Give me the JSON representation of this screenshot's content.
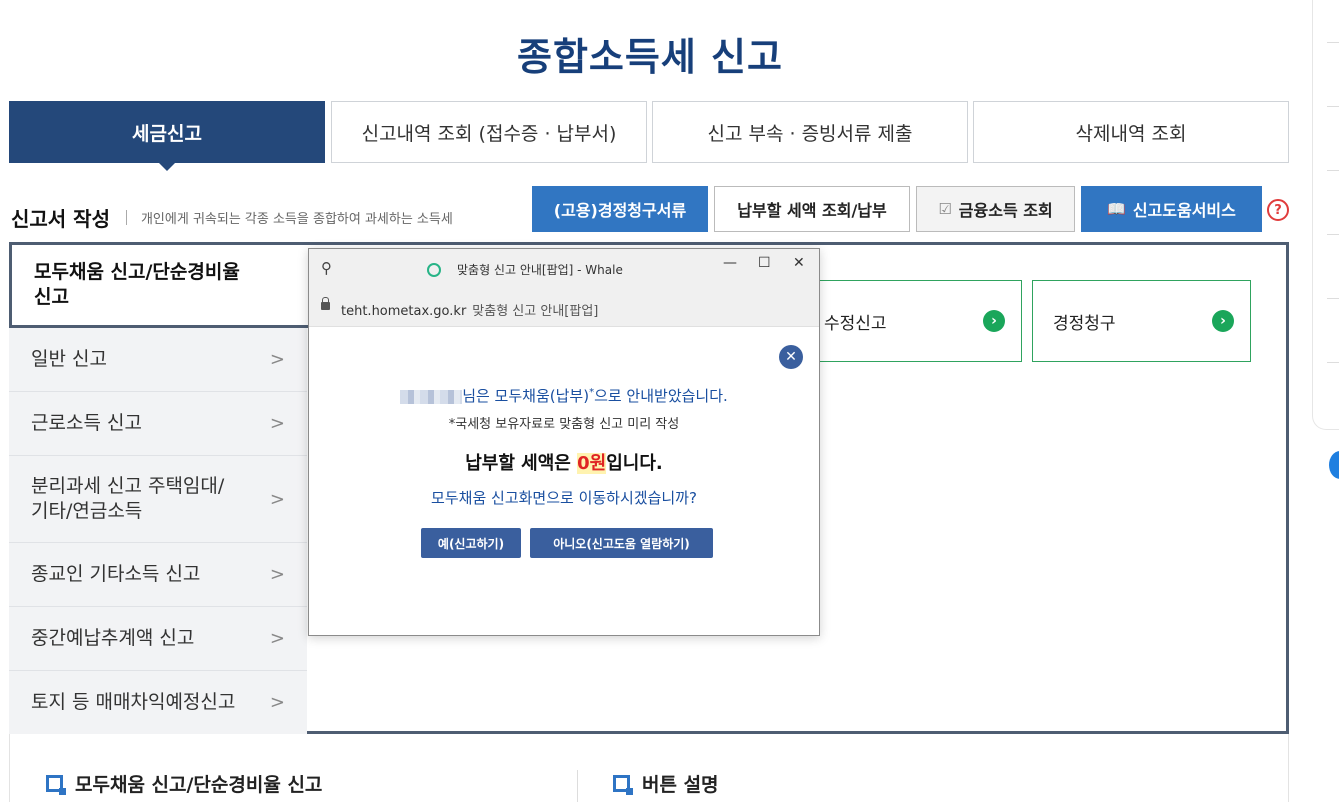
{
  "page": {
    "title": "종합소득세 신고"
  },
  "tabs": [
    {
      "label": "세금신고"
    },
    {
      "label": "신고내역 조회 (접수증 · 납부서)"
    },
    {
      "label": "신고 부속 · 증빙서류 제출"
    },
    {
      "label": "삭제내역 조회"
    }
  ],
  "section": {
    "title": "신고서 작성",
    "desc": "개인에게 귀속되는 각종 소득을 종합하여 과세하는 소득세"
  },
  "actions": {
    "correction_docs": "(고용)경정청구서류",
    "tax_payment": "납부할 세액 조회/납부",
    "financial_income": "금융소득 조회",
    "help_service": "신고도움서비스",
    "help_mark": "?"
  },
  "side_nav": [
    {
      "label": "모두채움 신고/단순경비율 신고"
    },
    {
      "label": "일반 신고"
    },
    {
      "label": "근로소득 신고"
    },
    {
      "label": "분리과세 신고 주택임대/기타/연금소득"
    },
    {
      "label": "종교인 기타소득 신고"
    },
    {
      "label": "중간예납추계액 신고"
    },
    {
      "label": "토지 등 매매차익예정신고"
    }
  ],
  "cards": [
    {
      "label": "수정신고"
    },
    {
      "label": "경정청구"
    }
  ],
  "bottom": {
    "left_heading": "모두채움 신고/단순경비율 신고",
    "right_heading": "버튼 설명"
  },
  "popup": {
    "window_title": "맞춤형 신고 안내[팝업] - Whale",
    "url_host": "teht.hometax.go.kr",
    "url_title": "맞춤형 신고 안내[팝업]",
    "msg_suffix": "님은 모두채움(납부)",
    "msg_star": "*",
    "msg_end": "으로 안내받았습니다.",
    "note": "*국세청 보유자료로 맞춤형 신고 미리 작성",
    "amount_prefix": "납부할 세액은 ",
    "amount": "0원",
    "amount_suffix": "입니다.",
    "question": "모두채움 신고화면으로 이동하시겠습니까?",
    "yes_button": "예(신고하기)",
    "no_button": "아니오(신고도움 열람하기)"
  },
  "colors": {
    "brand_navy": "#24487a",
    "action_blue": "#3176c2",
    "card_green": "#1aa65a",
    "popup_blue": "#3a5f9e",
    "amount_red": "#e02424"
  }
}
